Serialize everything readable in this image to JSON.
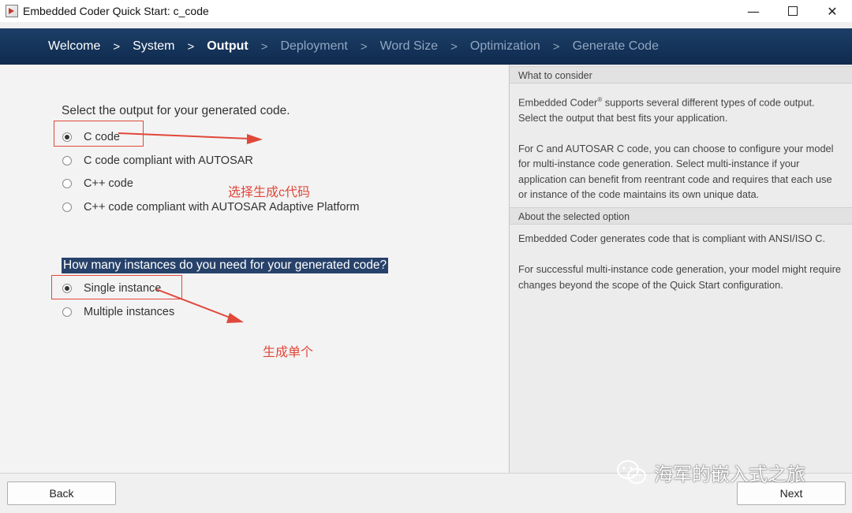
{
  "window": {
    "title": "Embedded Coder Quick Start: c_code",
    "minimize": "—",
    "close": "✕"
  },
  "steps": {
    "items": [
      {
        "label": "Welcome",
        "state": "done"
      },
      {
        "label": "System",
        "state": "done"
      },
      {
        "label": "Output",
        "state": "active"
      },
      {
        "label": "Deployment",
        "state": "todo"
      },
      {
        "label": "Word Size",
        "state": "todo"
      },
      {
        "label": "Optimization",
        "state": "todo"
      },
      {
        "label": "Generate Code",
        "state": "todo"
      }
    ],
    "separator": ">"
  },
  "output": {
    "question": "Select the output for your generated code.",
    "options": [
      {
        "label": "C code",
        "selected": true
      },
      {
        "label": "C code compliant with AUTOSAR",
        "selected": false
      },
      {
        "label": "C++ code",
        "selected": false
      },
      {
        "label": "C++ code compliant with AUTOSAR Adaptive Platform",
        "selected": false
      }
    ]
  },
  "instances": {
    "question": "How many instances do you need for your generated code?",
    "options": [
      {
        "label": "Single instance",
        "selected": true
      },
      {
        "label": "Multiple instances",
        "selected": false
      }
    ]
  },
  "annotations": {
    "note1": "选择生成c代码",
    "note2": "生成单个",
    "color": "#e0483a"
  },
  "consider": {
    "heading": "What to consider",
    "p1_brand": "Embedded Coder",
    "p1_reg": "®",
    "p1_rest": " supports several different types of code output.",
    "p1_line2": "Select the output that best fits your application.",
    "p2_lines": [
      "For C and AUTOSAR C code, you can choose to configure your model",
      "for multi-instance code generation. Select multi-instance if your",
      "application can benefit from reentrant code and requires that each use",
      "or instance of the code maintains its own unique data."
    ]
  },
  "about": {
    "heading": "About the selected option",
    "p1": "Embedded Coder generates code that is compliant with ANSI/ISO C.",
    "p2_lines": [
      "For successful multi-instance code generation, your model might require",
      "changes beyond the scope of the Quick Start configuration."
    ]
  },
  "buttons": {
    "back": "Back",
    "next": "Next"
  },
  "watermark": {
    "text": "海军的嵌入式之旅"
  }
}
